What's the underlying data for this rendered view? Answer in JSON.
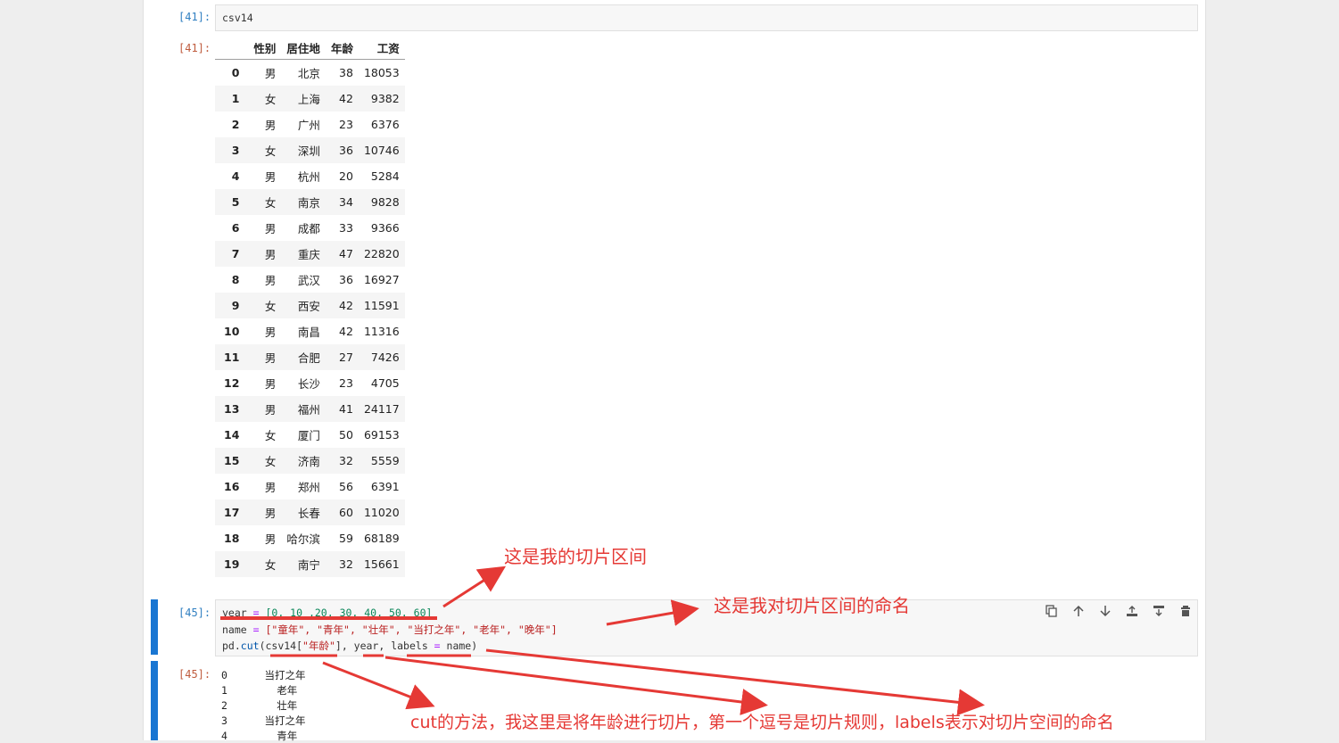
{
  "cell41": {
    "in_prompt": "[41]:",
    "code": "csv14",
    "out_prompt": "[41]:"
  },
  "table": {
    "columns": [
      "性别",
      "居住地",
      "年龄",
      "工资"
    ],
    "rows": [
      [
        "0",
        "男",
        "北京",
        "38",
        "18053"
      ],
      [
        "1",
        "女",
        "上海",
        "42",
        "9382"
      ],
      [
        "2",
        "男",
        "广州",
        "23",
        "6376"
      ],
      [
        "3",
        "女",
        "深圳",
        "36",
        "10746"
      ],
      [
        "4",
        "男",
        "杭州",
        "20",
        "5284"
      ],
      [
        "5",
        "女",
        "南京",
        "34",
        "9828"
      ],
      [
        "6",
        "男",
        "成都",
        "33",
        "9366"
      ],
      [
        "7",
        "男",
        "重庆",
        "47",
        "22820"
      ],
      [
        "8",
        "男",
        "武汉",
        "36",
        "16927"
      ],
      [
        "9",
        "女",
        "西安",
        "42",
        "11591"
      ],
      [
        "10",
        "男",
        "南昌",
        "42",
        "11316"
      ],
      [
        "11",
        "男",
        "合肥",
        "27",
        "7426"
      ],
      [
        "12",
        "男",
        "长沙",
        "23",
        "4705"
      ],
      [
        "13",
        "男",
        "福州",
        "41",
        "24117"
      ],
      [
        "14",
        "女",
        "厦门",
        "50",
        "69153"
      ],
      [
        "15",
        "女",
        "济南",
        "32",
        "5559"
      ],
      [
        "16",
        "男",
        "郑州",
        "56",
        "6391"
      ],
      [
        "17",
        "男",
        "长春",
        "60",
        "11020"
      ],
      [
        "18",
        "男",
        "哈尔滨",
        "59",
        "68189"
      ],
      [
        "19",
        "女",
        "南宁",
        "32",
        "15661"
      ]
    ]
  },
  "cell45": {
    "in_prompt": "[45]:",
    "out_prompt": "[45]:",
    "line1": {
      "a": "year ",
      "b": "= ",
      "c": "[0, 10 ,20, 30, 40, 50, 60]"
    },
    "line2": {
      "a": "name ",
      "b": "= ",
      "c": "[\"童年\", \"青年\", \"壮年\", \"当打之年\", \"老年\", \"晚年\"]"
    },
    "line3": {
      "a": "pd.",
      "b": "cut",
      "c": "(csv14[",
      "d": "\"年龄\"",
      "e": "], year, labels ",
      "f": "= ",
      "g": "name)"
    },
    "output_lines": [
      "0      当打之年",
      "1        老年",
      "2        壮年",
      "3      当打之年",
      "4        青年"
    ]
  },
  "toolbar": {
    "icons": [
      "copy-icon",
      "move-up-icon",
      "move-down-icon",
      "insert-above-icon",
      "insert-below-icon",
      "delete-icon"
    ]
  },
  "annotations": {
    "slice_interval": "这是我的切片区间",
    "slice_naming": "这是我对切片区间的命名",
    "cut_method": "cut的方法，我这里是将年龄进行切片，第一个逗号是切片规则，labels表示对切片空间的命名"
  },
  "colors": {
    "accent": "#1976d2",
    "annotation": "#e53935",
    "in_prompt": "#307fc1",
    "out_prompt": "#bf5b3d"
  }
}
